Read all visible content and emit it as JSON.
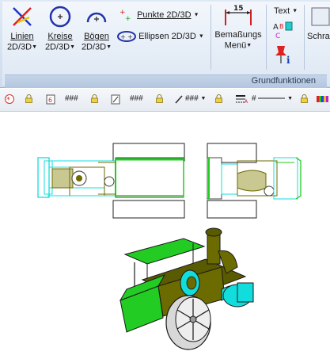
{
  "ribbon": {
    "linien": {
      "line1": "Linien",
      "line2": "2D/3D"
    },
    "kreise": {
      "line1": "Kreise",
      "line2": "2D/3D"
    },
    "boegen": {
      "line1": "Bögen",
      "line2": "2D/3D"
    },
    "punkte": "Punkte 2D/3D",
    "ellipsen": "Ellipsen 2D/3D",
    "bemassung": {
      "dim": "15",
      "line1": "Bemaßungs",
      "line2": "Menü"
    },
    "text": "Text",
    "schra": "Schra",
    "group_label": "Grundfunktionen"
  },
  "toolbar2": {
    "hash1": "###",
    "hash2": "###",
    "hash3": "###",
    "line_prefix": "#",
    "colors": {
      "red": "#e03030",
      "green": "#22cc22",
      "cyan": "#11dddd",
      "olive": "#6b6b00"
    }
  }
}
